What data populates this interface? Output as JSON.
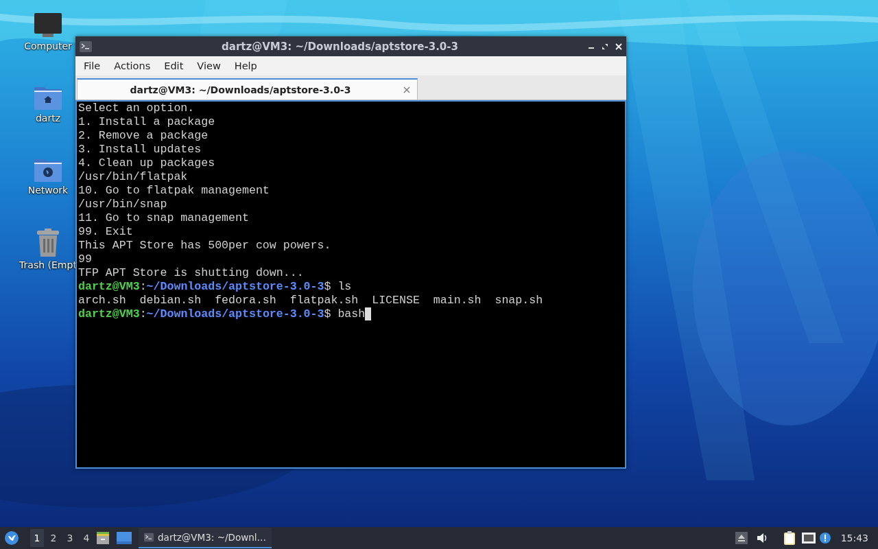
{
  "desktop": {
    "icons": [
      {
        "kind": "computer",
        "label": "Computer"
      },
      {
        "kind": "home",
        "label": "dartz"
      },
      {
        "kind": "network",
        "label": "Network"
      },
      {
        "kind": "trash",
        "label": "Trash (Empt"
      }
    ]
  },
  "window": {
    "title": "dartz@VM3: ~/Downloads/aptstore-3.0-3",
    "menu": [
      "File",
      "Actions",
      "Edit",
      "View",
      "Help"
    ],
    "tabs": [
      {
        "label": "dartz@VM3: ~/Downloads/aptstore-3.0-3",
        "selected": true
      }
    ],
    "terminal": {
      "lines": [
        {
          "kind": "output",
          "text": "Select an option."
        },
        {
          "kind": "output",
          "text": "1. Install a package"
        },
        {
          "kind": "output",
          "text": "2. Remove a package"
        },
        {
          "kind": "output",
          "text": "3. Install updates"
        },
        {
          "kind": "output",
          "text": "4. Clean up packages"
        },
        {
          "kind": "output",
          "text": "/usr/bin/flatpak"
        },
        {
          "kind": "output",
          "text": "10. Go to flatpak management"
        },
        {
          "kind": "output",
          "text": "/usr/bin/snap"
        },
        {
          "kind": "output",
          "text": "11. Go to snap management"
        },
        {
          "kind": "output",
          "text": "99. Exit"
        },
        {
          "kind": "output",
          "text": "This APT Store has 500per cow powers."
        },
        {
          "kind": "output",
          "text": "99"
        },
        {
          "kind": "output",
          "text": "TFP APT Store is shutting down..."
        },
        {
          "kind": "prompt",
          "user": "dartz@VM3",
          "colon": ":",
          "path": "~/Downloads/aptstore-3.0-3",
          "dollar": "$",
          "command": "ls",
          "cursor": false
        },
        {
          "kind": "output",
          "text": "arch.sh  debian.sh  fedora.sh  flatpak.sh  LICENSE  main.sh  snap.sh"
        },
        {
          "kind": "prompt",
          "user": "dartz@VM3",
          "colon": ":",
          "path": "~/Downloads/aptstore-3.0-3",
          "dollar": "$",
          "command": "bash",
          "cursor": true
        }
      ]
    }
  },
  "taskbar": {
    "workspaces": [
      {
        "label": "1",
        "selected": true
      },
      {
        "label": "2",
        "selected": false
      },
      {
        "label": "3",
        "selected": false
      },
      {
        "label": "4",
        "selected": false
      }
    ],
    "tasks": [
      {
        "label": "dartz@VM3: ~/Downl…",
        "selected": true
      }
    ],
    "clock": "15:43"
  }
}
